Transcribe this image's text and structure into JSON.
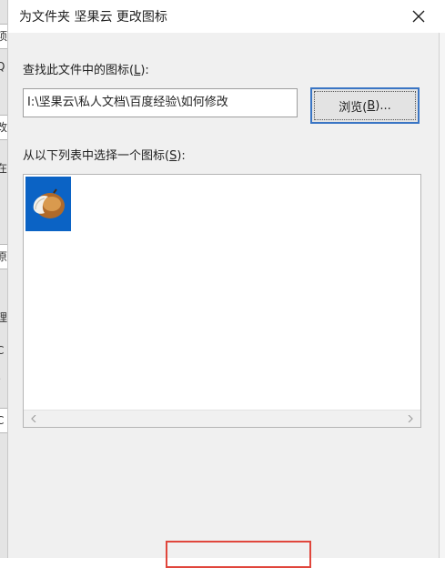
{
  "dialog": {
    "title": "为文件夹 坚果云 更改图标",
    "close_symbol": "✕"
  },
  "left_fragments": [
    "项",
    "Q",
    "改",
    "在",
    "原",
    "理",
    "C",
    "。",
    "C"
  ],
  "search": {
    "label": "查找此文件中的图标(",
    "label_key": "L",
    "label_end": "):",
    "path_value": "I:\\坚果云\\私人文档\\百度经验\\如何修改"
  },
  "browse_button": {
    "label": "浏览(",
    "key": "B",
    "label_end": ")..."
  },
  "list": {
    "label": "从以下列表中选择一个图标(",
    "label_key": "S",
    "label_end": "):",
    "items": [
      {
        "icon": "nut-icon",
        "selected": true
      }
    ]
  },
  "colors": {
    "selection": "#0b63c5",
    "focus_border": "#3a75c4",
    "highlight_red": "#e0463c"
  }
}
